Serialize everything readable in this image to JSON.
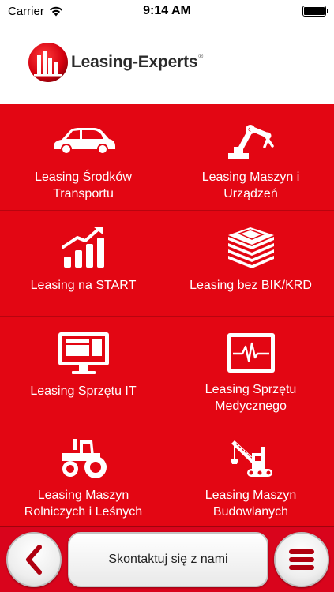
{
  "status_bar": {
    "carrier": "Carrier",
    "time": "9:14 AM"
  },
  "header": {
    "logo_text": "Leasing-Experts",
    "logo_reg": "®"
  },
  "tiles": [
    {
      "label": "Leasing Środków Transportu",
      "icon": "car-icon"
    },
    {
      "label": "Leasing Maszyn i Urządzeń",
      "icon": "robot-arm-icon"
    },
    {
      "label": "Leasing na START",
      "icon": "growth-chart-icon"
    },
    {
      "label": "Leasing bez BIK/KRD",
      "icon": "money-stack-icon"
    },
    {
      "label": "Leasing Sprzętu IT",
      "icon": "monitor-icon"
    },
    {
      "label": "Leasing Sprzętu Medycznego",
      "icon": "ekg-monitor-icon"
    },
    {
      "label": "Leasing Maszyn Rolniczych i Leśnych",
      "icon": "tractor-icon"
    },
    {
      "label": "Leasing Maszyn Budowlanych",
      "icon": "crane-icon"
    }
  ],
  "bottom_bar": {
    "contact_label": "Skontaktuj się z nami",
    "back_icon": "chevron-left-icon",
    "menu_icon": "hamburger-menu-icon"
  },
  "colors": {
    "brand_red": "#e30613",
    "tile_border": "#b8040f",
    "text_dark": "#2b2b2b"
  }
}
